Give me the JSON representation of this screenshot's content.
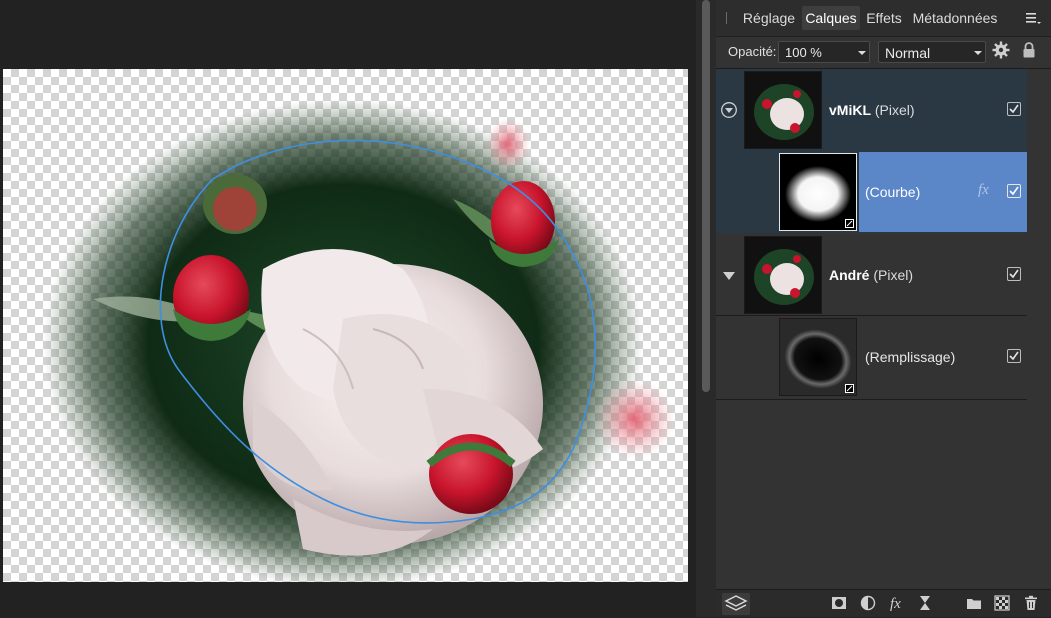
{
  "tabs": [
    {
      "label": "Réglage",
      "active": false
    },
    {
      "label": "Calques",
      "active": true
    },
    {
      "label": "Effets",
      "active": false
    },
    {
      "label": "Métadonnées",
      "active": false
    }
  ],
  "controls": {
    "opacity_label": "Opacité:",
    "opacity_value": "100 %",
    "blend_mode": "Normal"
  },
  "layers": [
    {
      "name": "vMiKL",
      "type": "(Pixel)",
      "expanded": true,
      "visible": true
    },
    {
      "name": "(Courbe)",
      "fx": "fx",
      "visible": true,
      "selected": true
    },
    {
      "name": "André",
      "type": "(Pixel)",
      "expanded": false,
      "visible": true
    },
    {
      "name": "(Remplissage)",
      "visible": true
    }
  ],
  "bottom_tools": [
    "layers-icon",
    "mask-icon",
    "adjustment-icon",
    "fx-icon",
    "live-filter-icon",
    "folder-icon",
    "pixel-layer-icon",
    "trash-icon"
  ],
  "colors": {
    "selected_row": "#5b86c8",
    "parent_row": "#2a3844",
    "selection_curve": "#3d8fe0"
  }
}
